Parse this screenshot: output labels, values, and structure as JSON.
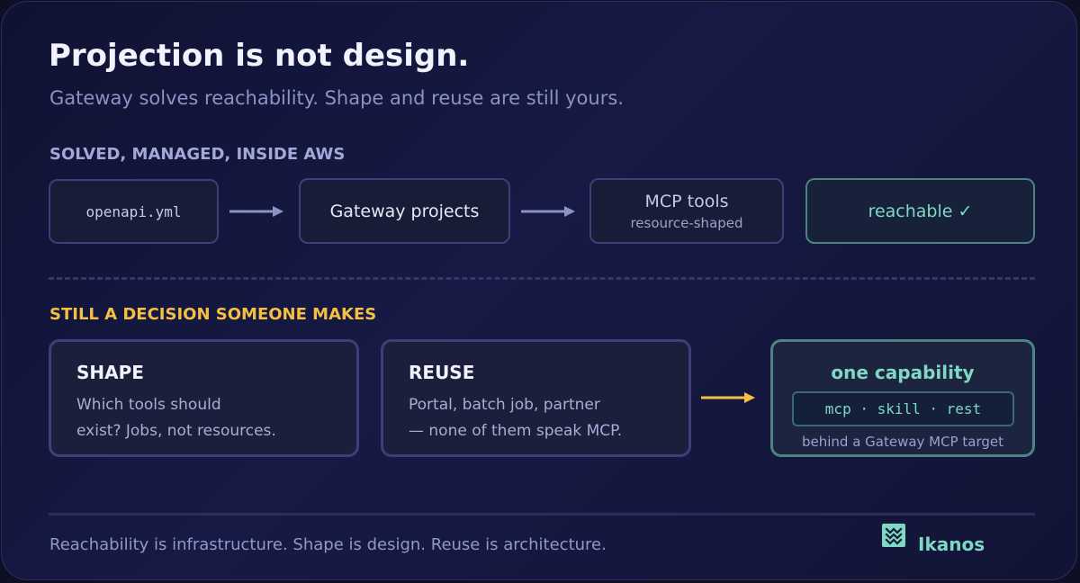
{
  "header": {
    "title": "Projection is not design.",
    "subtitle": "Gateway solves reachability. Shape and reuse are still yours."
  },
  "section_solved": {
    "heading": "SOLVED, MANAGED, INSIDE AWS",
    "steps": [
      {
        "label": "openapi.yml"
      },
      {
        "label": "Gateway projects"
      },
      {
        "label": "MCP tools",
        "sublabel": "resource-shaped"
      },
      {
        "label": "reachable ✓"
      }
    ]
  },
  "section_decision": {
    "heading": "STILL A DECISION SOMEONE MAKES",
    "cards": [
      {
        "heading": "SHAPE",
        "line1": "Which tools should",
        "line2": "exist? Jobs, not resources."
      },
      {
        "heading": "REUSE",
        "line1": "Portal, batch job, partner",
        "line2": "— none of them speak MCP."
      }
    ],
    "capability": {
      "heading": "one capability",
      "pill": "mcp · skill · rest",
      "footnote": "behind a Gateway MCP target"
    }
  },
  "footer": {
    "text": "Reachability is infrastructure. Shape is design. Reuse is architecture.",
    "brand": "Ikanos"
  },
  "colors": {
    "background": "#121436",
    "accent_teal": "#7fd8c3",
    "accent_gold": "#f4bf43",
    "box_border": "#3c407a"
  },
  "icons": {
    "arrow": "arrow-right-icon",
    "logo": "ikanos-logo-icon"
  }
}
